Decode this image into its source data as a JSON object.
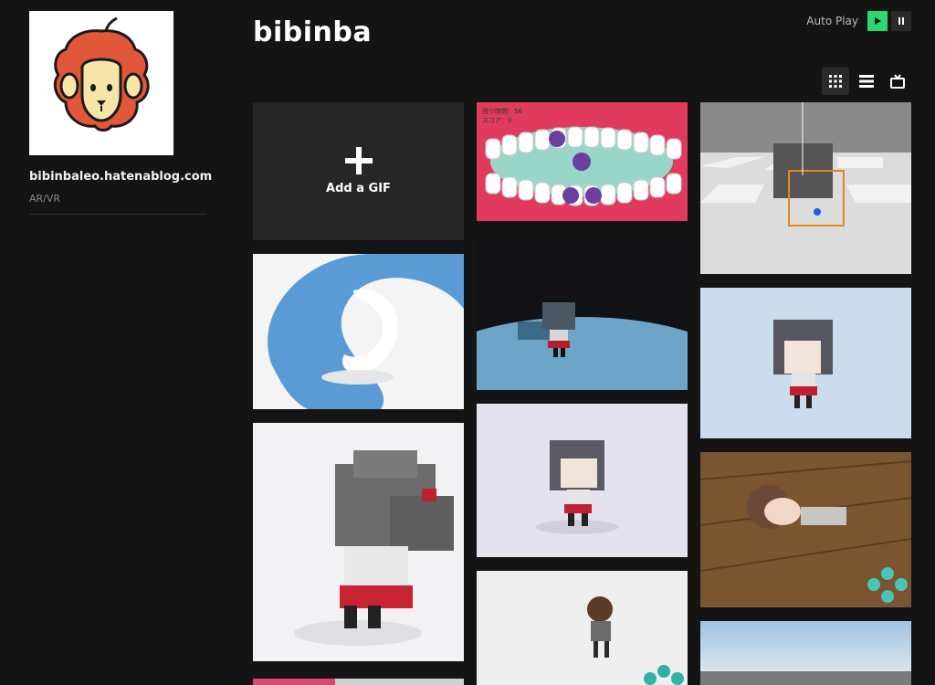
{
  "sidebar": {
    "blog_url": "bibinbaleo.hatenablog.com",
    "category": "AR/VR"
  },
  "header": {
    "title": "bibinba",
    "autoplay_label": "Auto Play"
  },
  "add_gif": {
    "label": "Add a GIF"
  },
  "teeth_game": {
    "timer_label": "残り時間：56",
    "score_label": "スコア：0"
  },
  "colors": {
    "accent_green": "#2ed573",
    "background": "#141414",
    "tile_dark": "#262626"
  }
}
